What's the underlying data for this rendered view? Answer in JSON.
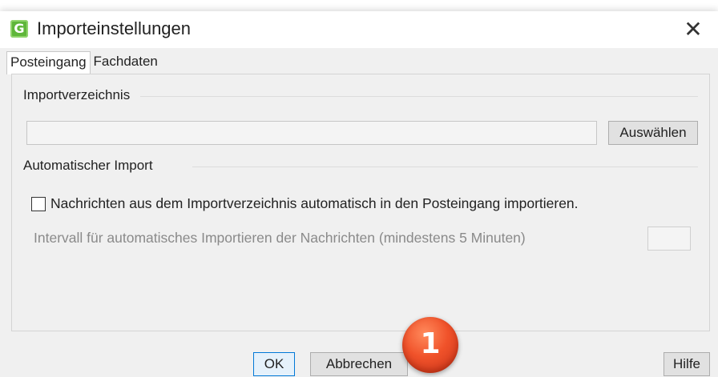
{
  "window": {
    "title": "Importeinstellungen",
    "app_icon_letter": "G",
    "close_glyph": "✕"
  },
  "tabs": [
    {
      "label": "Posteingang",
      "active": true
    },
    {
      "label": "Fachdaten",
      "active": false
    }
  ],
  "import_directory": {
    "group_label": "Importverzeichnis",
    "path_value": "",
    "choose_button": "Auswählen"
  },
  "auto_import": {
    "group_label": "Automatischer Import",
    "checkbox_label": "Nachrichten aus dem Importverzeichnis automatisch in den Posteingang importieren.",
    "checked": false,
    "interval_label": "Intervall für automatisches Importieren der Nachrichten (mindestens 5 Minuten)",
    "interval_value": ""
  },
  "footer": {
    "ok_button": "OK",
    "cancel_button": "Abbrechen",
    "help_button": "Hilfe"
  },
  "callout_badge": {
    "number": "1",
    "color": "#f0522a"
  },
  "colors": {
    "app_icon": "#5fb63a",
    "window_bg": "#f0f0f0"
  }
}
